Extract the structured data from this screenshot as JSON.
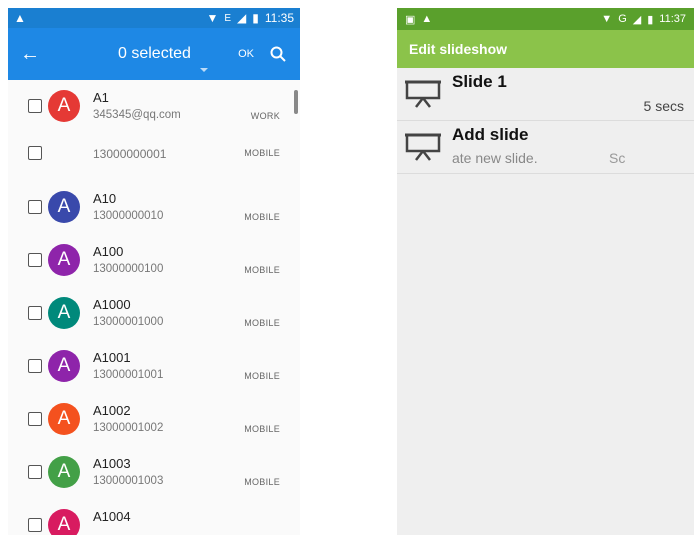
{
  "left_phone": {
    "status_time": "11:35",
    "status_network": "E",
    "selection_title": "0 selected",
    "ok_label": "OK",
    "contacts": [
      {
        "letter": "A",
        "name": "A1",
        "sub": "345345@qq.com",
        "tag": "WORK",
        "color": "#e53935"
      },
      {
        "letter": "",
        "name": "",
        "sub": "13000000001",
        "tag": "MOBILE",
        "color": ""
      },
      {
        "letter": "A",
        "name": "A10",
        "sub": "13000000010",
        "tag": "MOBILE",
        "color": "#3949ab"
      },
      {
        "letter": "A",
        "name": "A100",
        "sub": "13000000100",
        "tag": "MOBILE",
        "color": "#8e24aa"
      },
      {
        "letter": "A",
        "name": "A1000",
        "sub": "13000001000",
        "tag": "MOBILE",
        "color": "#00897b"
      },
      {
        "letter": "A",
        "name": "A1001",
        "sub": "13000001001",
        "tag": "MOBILE",
        "color": "#8e24aa"
      },
      {
        "letter": "A",
        "name": "A1002",
        "sub": "13000001002",
        "tag": "MOBILE",
        "color": "#f4511e"
      },
      {
        "letter": "A",
        "name": "A1003",
        "sub": "13000001003",
        "tag": "MOBILE",
        "color": "#43a047"
      },
      {
        "letter": "A",
        "name": "A1004",
        "sub": "",
        "tag": "",
        "color": "#d81b60"
      }
    ]
  },
  "right_phone": {
    "status_time": "11:37",
    "status_network": "G",
    "title": "Edit slideshow",
    "slides": [
      {
        "title": "Slide 1",
        "desc": "",
        "meta": "5 secs"
      },
      {
        "title": "Add slide",
        "desc": "ate new slide.",
        "meta": "Sc"
      }
    ]
  },
  "colors": {
    "left_appbar": "#1e88e5",
    "left_status": "#1a7fd1",
    "right_appbar": "#8bc34a",
    "right_status": "#5aa02c"
  }
}
